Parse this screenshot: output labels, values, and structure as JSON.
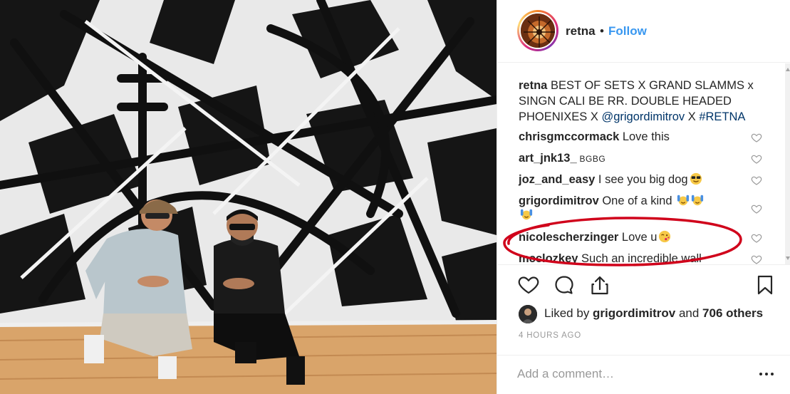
{
  "post": {
    "username": "retna",
    "separator": "•",
    "follow_label": "Follow",
    "caption": {
      "username": "retna",
      "text": " BEST OF SETS X GRAND SLAMMS x SINGN CALI BE RR. DOUBLE HEADED PHOENIXES X ",
      "mention": "@grigordimitrov",
      "text_after": " X ",
      "hashtag": "#RETNA"
    },
    "comments": [
      {
        "username": "chrisgmccormack",
        "text": " Love this"
      },
      {
        "username": "art_jnk13_",
        "text": " BGBG"
      },
      {
        "username": "joz_and_easy",
        "text": " I see you big dog"
      },
      {
        "username": "grigordimitrov",
        "text": " One of a kind"
      },
      {
        "username": "nicolescherzinger",
        "text": " Love u"
      },
      {
        "username": "mcclozkey",
        "text": " Such an incredible wall"
      }
    ],
    "likes": {
      "prefix": "Liked by ",
      "user": "grigordimitrov",
      "middle": " and ",
      "count": "706 others"
    },
    "timestamp": "4 HOURS AGO",
    "add_comment_placeholder": "Add a comment…"
  },
  "colors": {
    "link_blue": "#3897f0",
    "mention_blue": "#003569",
    "annotation_red": "#d0021b",
    "text_dark": "#262626",
    "text_muted": "#999999"
  },
  "icons": [
    "heart-icon",
    "comment-icon",
    "share-icon",
    "bookmark-icon",
    "more-options-icon"
  ]
}
